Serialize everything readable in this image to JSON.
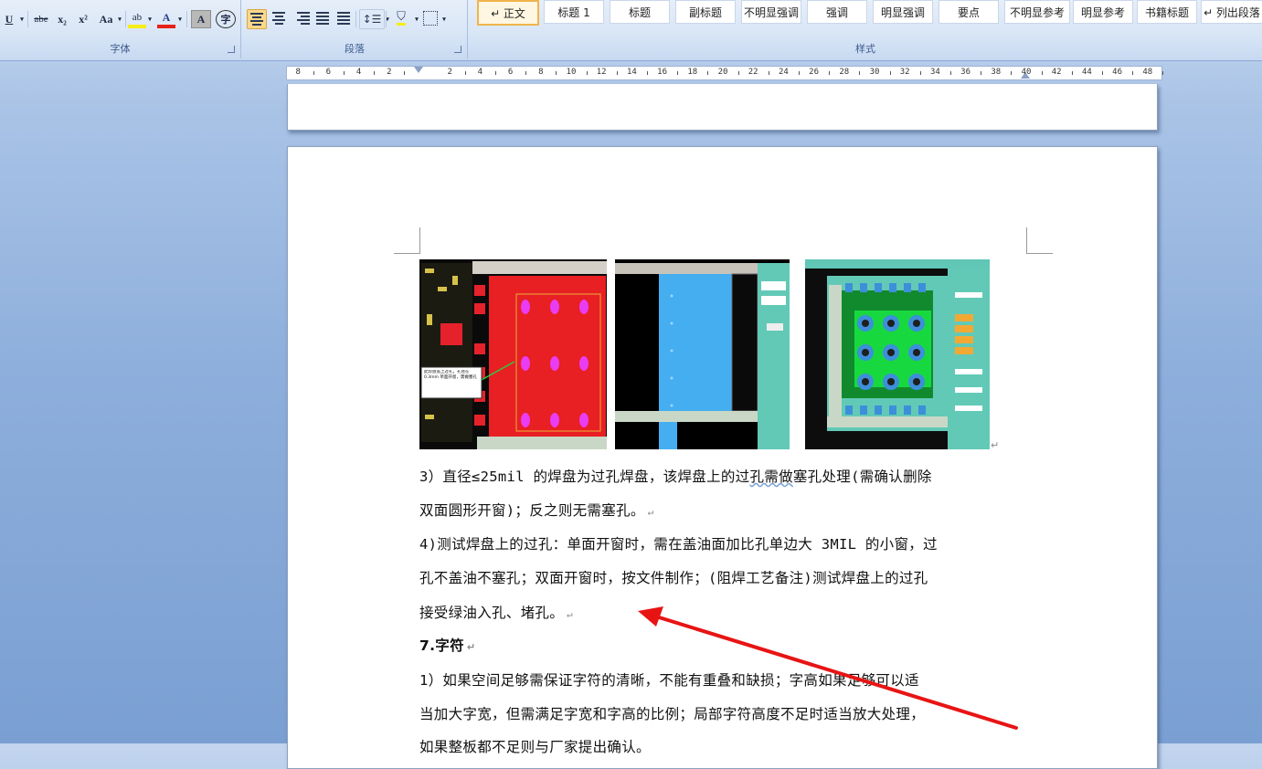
{
  "ribbon": {
    "font_group": {
      "label": "字体",
      "buttons": {
        "underline": "U",
        "strike": "abe",
        "subscript": "x₂",
        "superscript": "x²",
        "case": "Aa",
        "highlight": "ab",
        "font_color": "A",
        "char_shade": "A",
        "enclose": "字"
      }
    },
    "paragraph_group": {
      "label": "段落"
    },
    "styles_group": {
      "label": "样式",
      "items": [
        "↵ 正文",
        "标题 1",
        "标题",
        "副标题",
        "不明显强调",
        "强调",
        "明显强调",
        "要点",
        "不明显参考",
        "明显参考",
        "书籍标题",
        "↵ 列出段落"
      ]
    }
  },
  "ruler": {
    "numbers": [
      "8",
      "6",
      "4",
      "2",
      "2",
      "4",
      "6",
      "8",
      "10",
      "12",
      "14",
      "16",
      "18",
      "20",
      "22",
      "24",
      "26",
      "28",
      "30",
      "32",
      "34",
      "36",
      "38",
      "40",
      "42",
      "44",
      "46",
      "48"
    ]
  },
  "document": {
    "paragraphs": [
      {
        "lines": [
          {
            "pre": "3）直径≤25mil 的焊盘为过孔焊盘，该焊盘上的过",
            "wavy": "孔需做",
            "post": "塞孔处理(需确认删除"
          },
          {
            "text": "双面圆形开窗)；反之则无需塞孔。",
            "mark": "↵"
          }
        ]
      },
      {
        "lines": [
          {
            "text": "4)测试焊盘上的过孔：单面开窗时，需在盖油面加比孔单边大 3MIL 的小窗，过"
          },
          {
            "text": "孔不盖油不塞孔；双面开窗时，按文件制作；(阻焊工艺备注)测试焊盘上的过孔"
          },
          {
            "text": "接受绿油入孔、堵孔。",
            "mark": "↵"
          }
        ]
      },
      {
        "heading": "7.字符",
        "mark": "↵"
      },
      {
        "lines": [
          {
            "text": "1）如果空间足够需保证字符的清晰，不能有重叠和缺损；字高如果足够可以适"
          },
          {
            "text": "当加大字宽，但需满足字宽和字高的比例；局部字符高度不足时适当放大处理，"
          },
          {
            "text": "如果整板都不足则与厂家提出确认。"
          }
        ]
      }
    ],
    "image_popup_text": "此焊盘盖上过孔，孔径在0.3mm 单面开窗，需做塞孔",
    "image_mark": "↵"
  },
  "colors": {
    "annotation_arrow": "#e81414"
  }
}
